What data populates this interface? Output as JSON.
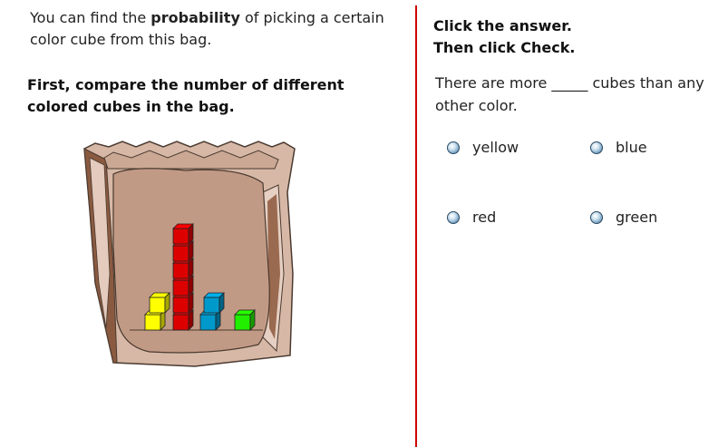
{
  "left": {
    "intro_before": "You can find the ",
    "intro_bold": "probability",
    "intro_after": " of picking a certain color cube from this bag.",
    "instruction": "First, compare the number of different colored cubes in the bag."
  },
  "right": {
    "title_line1": "Click the answer.",
    "title_line2": "Then click Check.",
    "question": "There are more _____ cubes than any other color.",
    "options": [
      {
        "label": "yellow"
      },
      {
        "label": "blue"
      },
      {
        "label": "red"
      },
      {
        "label": "green"
      }
    ]
  },
  "bag": {
    "cube_counts": {
      "yellow": 2,
      "red": 6,
      "blue": 2,
      "green": 1
    }
  },
  "colors": {
    "divider": "#cc0000",
    "bag_outer": "#d7b8a6",
    "bag_inner": "#c19a85",
    "red_cube": "#dd0000",
    "yellow_cube": "#ffff00",
    "blue_cube": "#0099cc",
    "green_cube": "#22ee00"
  }
}
